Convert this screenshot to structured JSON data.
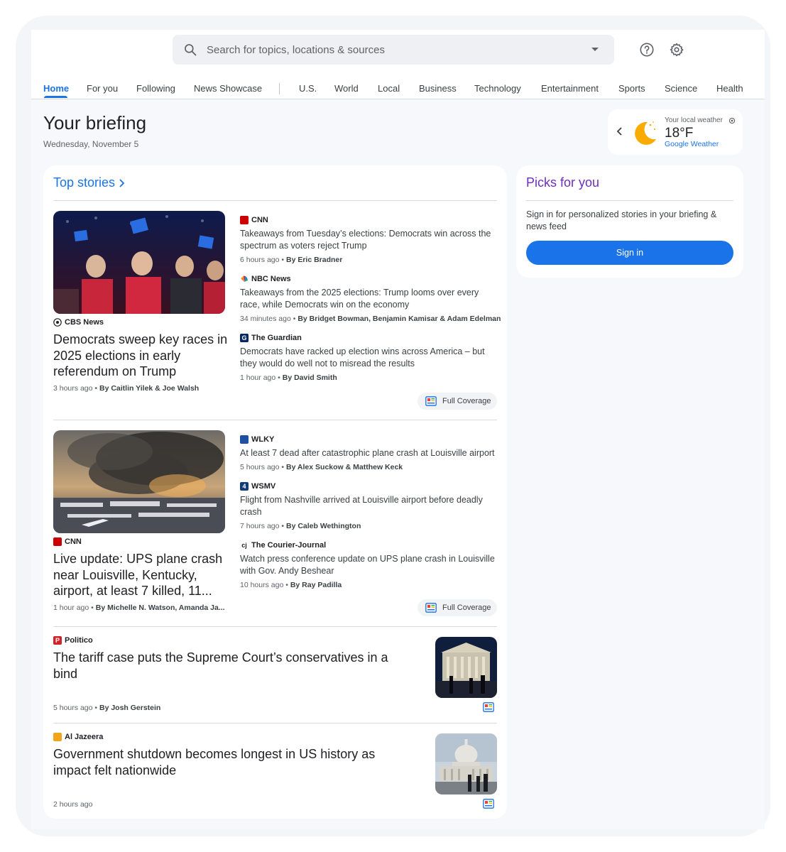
{
  "search": {
    "placeholder": "Search for topics, locations & sources"
  },
  "nav": {
    "tabs": [
      "Home",
      "For you",
      "Following",
      "News Showcase",
      "U.S.",
      "World",
      "Local",
      "Business",
      "Technology",
      "Entertainment",
      "Sports",
      "Science",
      "Health"
    ],
    "active": "Home"
  },
  "briefing": {
    "title": "Your briefing",
    "date": "Wednesday, November 5"
  },
  "weather": {
    "label": "Your local weather",
    "temp": "18°F",
    "link": "Google Weather"
  },
  "top_stories": {
    "heading": "Top stories",
    "full_coverage_label": "Full Coverage",
    "clusters": [
      {
        "main": {
          "source": "CBS News",
          "title": "Democrats sweep key races in 2025 elections in early referendum on Trump",
          "time": "3 hours ago",
          "byline": "By Caitlin Yilek & Joe Walsh"
        },
        "related": [
          {
            "source": "CNN",
            "title": "Takeaways from Tuesday’s elections: Democrats win across the spectrum as voters reject Trump",
            "time": "6 hours ago",
            "byline": "By Eric Bradner"
          },
          {
            "source": "NBC News",
            "title": "Takeaways from the 2025 elections: Trump looms over every race, while Democrats win on the economy",
            "time": "34 minutes ago",
            "byline": "By Bridget Bowman, Benjamin Kamisar & Adam Edelman"
          },
          {
            "source": "The Guardian",
            "title": "Democrats have racked up election wins across America – but they would do well not to misread the results",
            "time": "1 hour ago",
            "byline": "By David Smith"
          }
        ]
      },
      {
        "main": {
          "source": "CNN",
          "title": "Live update: UPS plane crash near Louisville, Kentucky, airport, at least 7 killed, 11...",
          "time": "1 hour ago",
          "byline": "By Michelle N. Watson, Amanda Ja..."
        },
        "related": [
          {
            "source": "WLKY",
            "title": "At least 7 dead after catastrophic plane crash at Louisville airport",
            "time": "5 hours ago",
            "byline": "By Alex Suckow & Matthew Keck"
          },
          {
            "source": "WSMV",
            "title": "Flight from Nashville arrived at Louisville airport before deadly crash",
            "time": "7 hours ago",
            "byline": "By Caleb Wethington"
          },
          {
            "source": "The Courier-Journal",
            "title": "Watch press conference update on UPS plane crash in Louisville with Gov. Andy Beshear",
            "time": "10 hours ago",
            "byline": "By Ray Padilla"
          }
        ]
      }
    ],
    "singles": [
      {
        "source": "Politico",
        "title": "The tariff case puts the Supreme Court’s conservatives in a bind",
        "time": "5 hours ago",
        "byline": "By Josh Gerstein"
      },
      {
        "source": "Al Jazeera",
        "title": "Government shutdown becomes longest in US history as impact felt nationwide",
        "time": "2 hours ago",
        "byline": ""
      }
    ]
  },
  "picks": {
    "title": "Picks for you",
    "text": "Sign in for personalized stories in your briefing & news feed",
    "button": "Sign in"
  },
  "colors": {
    "accent": "#1a73e8",
    "picks_title": "#6f2dbd",
    "cnn_red": "#cc0000",
    "politico_red": "#d1232a",
    "aljazeera_orange": "#f2a51a"
  }
}
